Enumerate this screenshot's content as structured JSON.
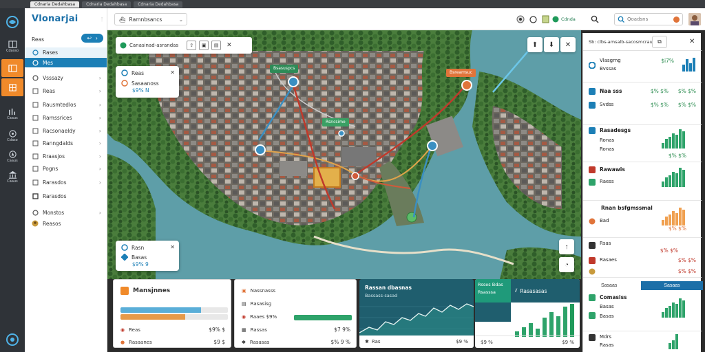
{
  "browser": {
    "tabs": [
      "Cdnaria Dedahbasa",
      "Cdnaria Dedahbasa",
      "Cdnaria Dedahbasa"
    ],
    "active_tab": 0
  },
  "rail": {
    "items": [
      {
        "icon": "book-icon",
        "label": "Cdasso"
      },
      {
        "icon": "panel-icon",
        "label": ""
      },
      {
        "icon": "layers-icon",
        "label": ""
      },
      {
        "icon": "chart-icon",
        "label": "Caaus"
      },
      {
        "icon": "network-icon",
        "label": "Cdaso"
      },
      {
        "icon": "compass-icon",
        "label": "Caaus"
      },
      {
        "icon": "bank-icon",
        "label": "Caaus"
      }
    ],
    "active_indices": [
      1,
      2
    ]
  },
  "nav": {
    "title": "Vlonarjai",
    "pill_icon": "back-arrow-icon",
    "items": [
      {
        "label": "Reas",
        "icon": "",
        "chevron": false
      },
      {
        "label": "Rases",
        "icon": "circle-icon",
        "chevron": false,
        "highlight": true
      },
      {
        "label": "Mes",
        "icon": "circle-icon",
        "chevron": false,
        "selected": true
      },
      {
        "label": "Vsssazy",
        "icon": "circle-icon",
        "chevron": true
      },
      {
        "label": "Reas",
        "icon": "square-icon",
        "chevron": true
      },
      {
        "label": "Rausmtedlos",
        "icon": "square-icon",
        "chevron": true
      },
      {
        "label": "Ramssrices",
        "icon": "square-icon",
        "chevron": true
      },
      {
        "label": "Racsonaeldy",
        "icon": "square-icon",
        "chevron": true
      },
      {
        "label": "Ranngdalds",
        "icon": "square-icon",
        "chevron": true
      },
      {
        "label": "Rraasjos",
        "icon": "square-icon",
        "chevron": true
      },
      {
        "label": "Pogns",
        "icon": "square-icon",
        "chevron": true
      },
      {
        "label": "Rarasdos",
        "icon": "square-icon",
        "chevron": false
      },
      {
        "label": "Monstos",
        "icon": "circle-icon",
        "chevron": true
      },
      {
        "label": "Reasos",
        "icon": "avatar-icon",
        "chevron": false
      }
    ]
  },
  "header": {
    "dropdown_label": "Ramnbsancs",
    "chip_label": "Cdnda",
    "search_placeholder": "Qoadsns"
  },
  "map": {
    "toolbar_label": "Canasinad-asrandas",
    "card_top": {
      "title": "Reas",
      "sub": "Sasaanoss",
      "value": "$9% N"
    },
    "card_bottom": {
      "title": "Rasn",
      "sub": "Basas",
      "value": "$9% 9"
    },
    "pins": [
      {
        "label": "Bsasuspcs",
        "color": "#2e8b57"
      },
      {
        "label": "Bsreamsuc",
        "color": "#e0743a"
      },
      {
        "label": "Rsncsimo",
        "color": "#3aa064"
      }
    ]
  },
  "rpanel": {
    "head_label": "Sb: clbs-amsalb-sacosmcrau",
    "sections": [
      {
        "title": "Vlasgrng",
        "sub": "Bvssas",
        "v1": "$i7%",
        "v2": "",
        "icon_color": "#1c7fb6",
        "bar_color": "#1c7fb6",
        "bars": [
          0.5,
          0.9,
          0.6,
          1.0
        ]
      },
      {
        "title": "Naa sss",
        "sub": "Svdss",
        "v1": "$% $%",
        "v2": "$% $%",
        "icon_color": "#1c7fb6",
        "bar_color": "",
        "bars": []
      },
      {
        "title": "Rasadesgs",
        "sub": "Ronas",
        "v1": "$i7%",
        "v2": "$% $%",
        "icon_color": "#1c7fb6",
        "bar_color": "#2ea36a",
        "bars": [
          0.3,
          0.5,
          0.6,
          0.8,
          0.7,
          1.0,
          0.9
        ]
      },
      {
        "title": "Rawawis",
        "sub": "Raess",
        "v1": "",
        "v2": "$% $%",
        "icon_color": "#c0392b",
        "bar_color": "#2ea36a",
        "bars": [
          0.3,
          0.5,
          0.6,
          0.8,
          0.7,
          1.0,
          0.9
        ]
      },
      {
        "title": "Rnan bsfgmssmal",
        "sub": "Bad",
        "v1": "$% $%",
        "v2": "",
        "icon_color": "#e0743a",
        "bar_color": "#f0a050",
        "bars": [
          0.3,
          0.5,
          0.6,
          0.8,
          0.7,
          1.0,
          0.9
        ]
      },
      {
        "title": "Rsas",
        "sub": "Rasaes",
        "v1": "$% $%",
        "v2": "$% $%",
        "icon_color": "#c0392b",
        "bar_color": "",
        "bars": []
      },
      {
        "title": "Comasiss",
        "sub": "Basas",
        "v1": "$% $%",
        "v2": "",
        "icon_color": "#2ea36a",
        "bar_color": "#2ea36a",
        "bars": [
          0.3,
          0.5,
          0.6,
          0.8,
          0.7,
          1.0,
          0.9
        ]
      },
      {
        "title": "Mdrs",
        "sub": "Rasas",
        "v1": "$% $%",
        "v2": "",
        "icon_color": "#333",
        "bar_color": "#2ea36a",
        "bars": [
          0.4,
          0.6,
          1.0
        ]
      }
    ],
    "highlight_label": "Sasaas"
  },
  "bottom": {
    "card1": {
      "title": "Mansjnnes",
      "r1": "Reas",
      "v1": "$9% $",
      "r2": "Rasaanes",
      "v2": "$9 $",
      "fill1": 0.75,
      "fill2": 0.6
    },
    "card2": {
      "r1": "Nassnasss",
      "r2": "Rasasisg",
      "r3": "Raaes $9%",
      "r4": "Rassas",
      "v4": "$7 9%",
      "r5": "Rasasas",
      "v5": "$% 9 %",
      "fill3": 1.0
    },
    "card3": {
      "title": "Rassan dbasnas",
      "sub": "Bassass-sasad",
      "foot_l": "Ras",
      "foot_r": "$9 %"
    },
    "card4": {
      "tab1": "Rsses Bdas",
      "tab2": "Rsasssa",
      "title": "Rasasasas",
      "foot_l": "$9 %",
      "foot_r": "$9 %"
    }
  }
}
